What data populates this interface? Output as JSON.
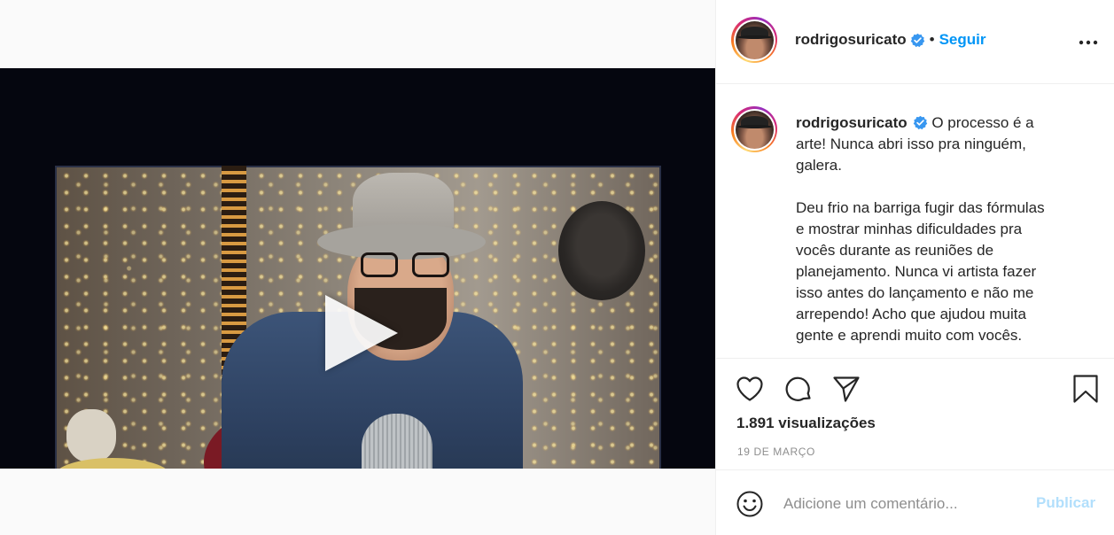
{
  "colors": {
    "link": "#0095f6",
    "text": "#262626",
    "muted": "#8e8e8e",
    "publish_disabled": "#b2dffc",
    "verified": "#3897f0"
  },
  "post": {
    "username": "rodrigosuricato",
    "follow_label": "Seguir",
    "separator": "•",
    "caption": {
      "lines_para1": [
        "O processo é a",
        "arte! Nunca abri isso pra ninguém,",
        "galera."
      ],
      "lines_para2": [
        "Deu frio na barriga fugir das fórmulas",
        "e mostrar minhas dificuldades pra",
        "vocês durante as reuniões de",
        "planejamento. Nunca vi artista fazer",
        "isso antes do lançamento e não me",
        "arrependo! Acho que ajudou muita",
        "gente e aprendi muito com vocês."
      ]
    },
    "views": "1.891 visualizações",
    "date": "19 de março"
  },
  "comment": {
    "placeholder": "Adicione um comentário...",
    "publish_label": "Publicar"
  },
  "icons": {
    "header_more": "more-horizontal-icon",
    "like": "heart-icon",
    "comment": "comment-bubble-icon",
    "share": "paper-plane-icon",
    "save": "bookmark-icon",
    "emoji": "smiley-icon",
    "play": "play-icon",
    "tag": "person-icon",
    "mute": "muted-speaker-icon"
  }
}
